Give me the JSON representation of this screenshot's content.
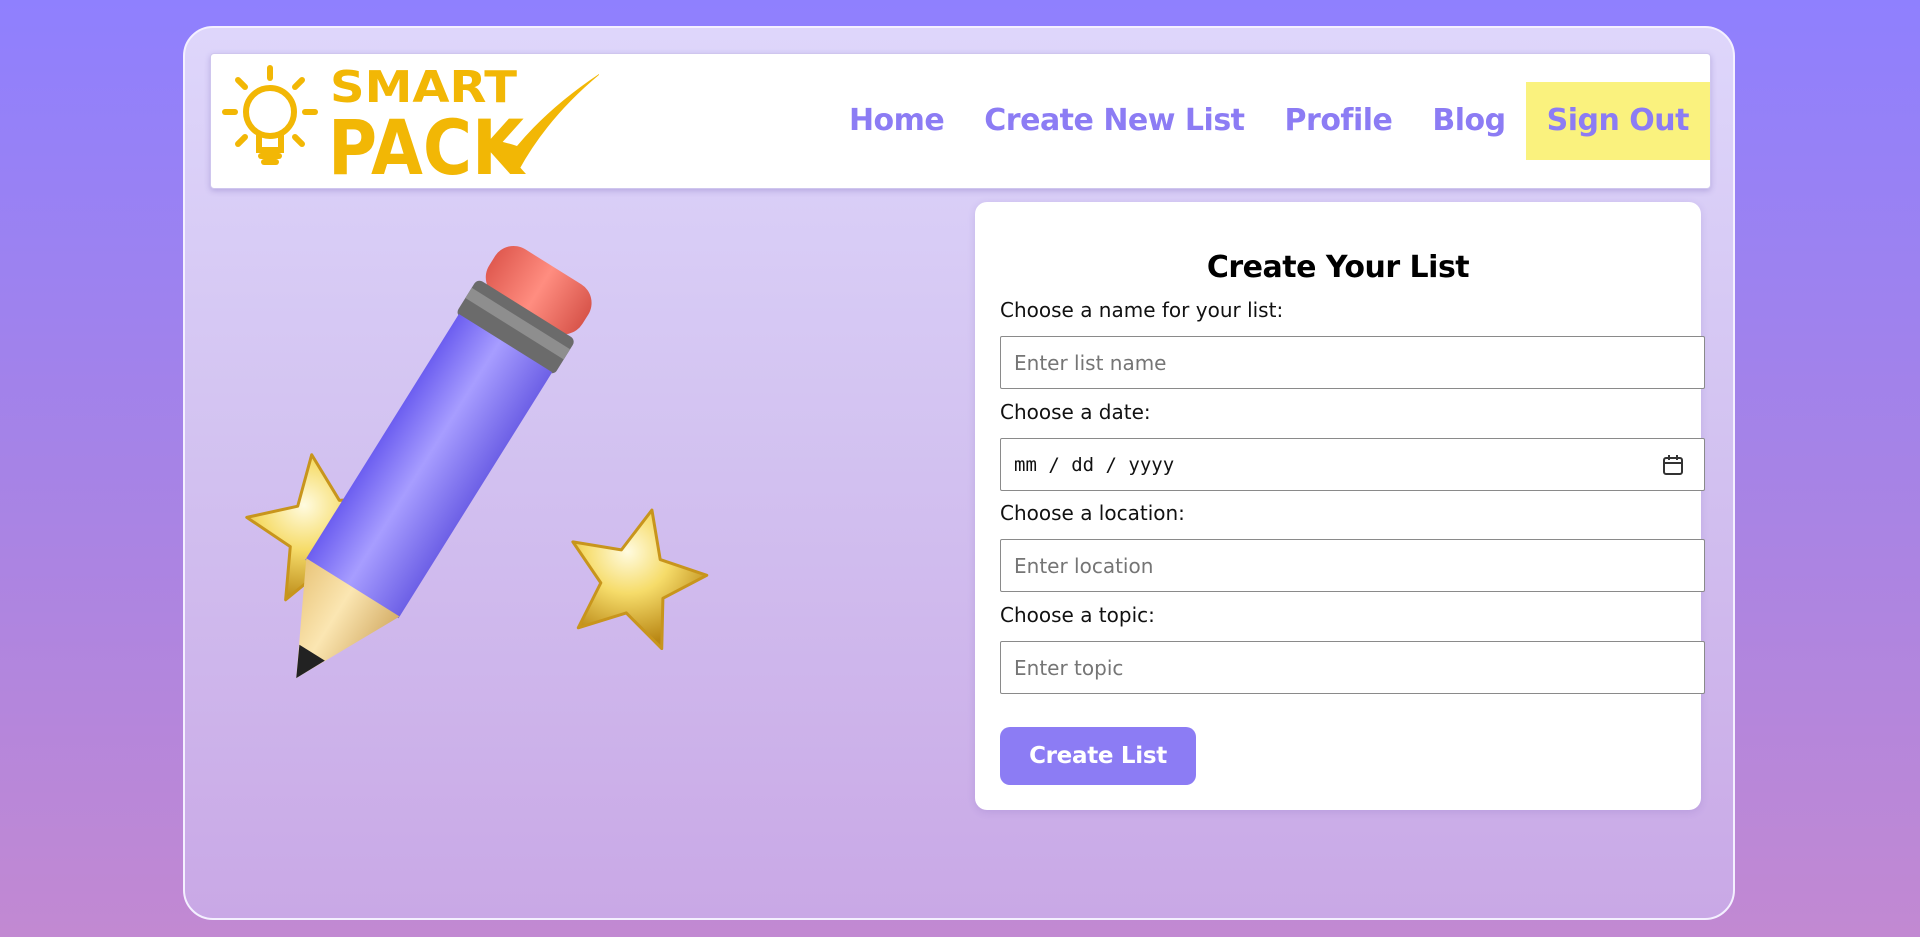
{
  "brand": {
    "line1": "SMART",
    "line2": "PACK",
    "color": "#f2b705"
  },
  "nav": {
    "home": "Home",
    "create_new_list": "Create New List",
    "profile": "Profile",
    "blog": "Blog",
    "sign_out": "Sign Out"
  },
  "hero": {
    "icon": "pencil-with-stars-icon"
  },
  "form": {
    "title": "Create Your List",
    "name_label": "Choose a name for your list:",
    "name_placeholder": "Enter list name",
    "date_label": "Choose a date:",
    "date_value": "mm / dd / yyyy",
    "location_label": "Choose a location:",
    "location_placeholder": "Enter location",
    "topic_label": "Choose a topic:",
    "topic_placeholder": "Enter topic",
    "submit_label": "Create List"
  },
  "colors": {
    "accent": "#8c7cf4",
    "signout_highlight": "#faf27e",
    "background_top": "#8f80fe",
    "background_bottom": "#c289d2"
  }
}
